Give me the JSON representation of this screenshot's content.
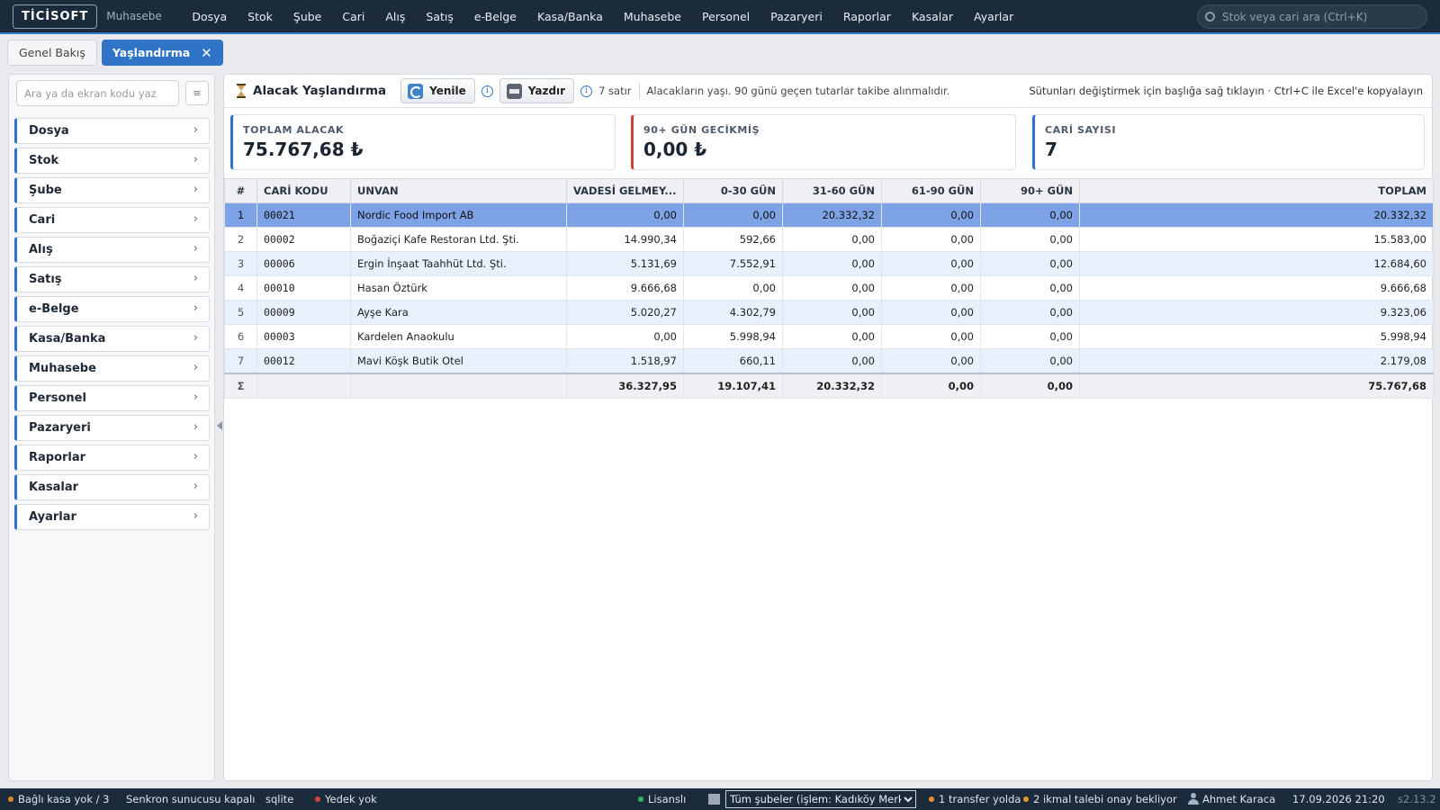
{
  "header": {
    "logo": "TİCİSOFT",
    "app_name": "Muhasebe",
    "menu": [
      "Dosya",
      "Stok",
      "Şube",
      "Cari",
      "Alış",
      "Satış",
      "e-Belge",
      "Kasa/Banka",
      "Muhasebe",
      "Personel",
      "Pazaryeri",
      "Raporlar",
      "Kasalar",
      "Ayarlar"
    ],
    "search_placeholder": "Stok veya cari ara (Ctrl+K)"
  },
  "tabs": {
    "overview": "Genel Bakış",
    "active": "Yaşlandırma",
    "close": "✕"
  },
  "sidebar": {
    "search_placeholder": "Ara ya da ekran kodu yaz",
    "menu_button": "≡",
    "items": [
      "Dosya",
      "Stok",
      "Şube",
      "Cari",
      "Alış",
      "Satış",
      "e-Belge",
      "Kasa/Banka",
      "Muhasebe",
      "Personel",
      "Pazaryeri",
      "Raporlar",
      "Kasalar",
      "Ayarlar"
    ]
  },
  "toolbar": {
    "title": "Alacak Yaşlandırma",
    "refresh": "Yenile",
    "print": "Yazdır",
    "row_count": "7 satır",
    "note": "Alacakların yaşı. 90 günü geçen tutarlar takibe alınmalıdır.",
    "hint": "Sütunları değiştirmek için başlığa sağ tıklayın · Ctrl+C ile Excel'e kopyalayın"
  },
  "cards": [
    {
      "label": "TOPLAM ALACAK",
      "value": "75.767,68 ₺"
    },
    {
      "label": "90+ GÜN GECİKMİŞ",
      "value": "0,00 ₺"
    },
    {
      "label": "CARİ SAYISI",
      "value": "7"
    }
  ],
  "table": {
    "headers": [
      "#",
      "CARİ KODU",
      "UNVAN",
      "VADESİ GELMEY...",
      "0-30 GÜN",
      "31-60 GÜN",
      "61-90 GÜN",
      "90+ GÜN",
      "TOPLAM"
    ],
    "rows": [
      [
        "1",
        "00021",
        "Nordic Food Import AB",
        "0,00",
        "0,00",
        "20.332,32",
        "0,00",
        "0,00",
        "20.332,32"
      ],
      [
        "2",
        "00002",
        "Boğaziçi Kafe Restoran Ltd. Şti.",
        "14.990,34",
        "592,66",
        "0,00",
        "0,00",
        "0,00",
        "15.583,00"
      ],
      [
        "3",
        "00006",
        "Ergin İnşaat Taahhüt Ltd. Şti.",
        "5.131,69",
        "7.552,91",
        "0,00",
        "0,00",
        "0,00",
        "12.684,60"
      ],
      [
        "4",
        "00010",
        "Hasan Öztürk",
        "9.666,68",
        "0,00",
        "0,00",
        "0,00",
        "0,00",
        "9.666,68"
      ],
      [
        "5",
        "00009",
        "Ayşe Kara",
        "5.020,27",
        "4.302,79",
        "0,00",
        "0,00",
        "0,00",
        "9.323,06"
      ],
      [
        "6",
        "00003",
        "Kardelen Anaokulu",
        "0,00",
        "5.998,94",
        "0,00",
        "0,00",
        "0,00",
        "5.998,94"
      ],
      [
        "7",
        "00012",
        "Mavi Köşk Butik Otel",
        "1.518,97",
        "660,11",
        "0,00",
        "0,00",
        "0,00",
        "2.179,08"
      ]
    ],
    "total": [
      "Σ",
      "",
      "",
      "36.327,95",
      "19.107,41",
      "20.332,32",
      "0,00",
      "0,00",
      "75.767,68"
    ]
  },
  "status": {
    "cash": "Bağlı kasa yok / 3",
    "sync": "Senkron sunucusu kapalı",
    "db": "sqlite",
    "backup": "Yedek yok",
    "license": "Lisanslı",
    "branch": "Tüm şubeler (işlem: Kadıköy Merkez)",
    "transfer": "1 transfer yolda",
    "requests": "2 ikmal talebi onay bekliyor",
    "user": "Ahmet Karaca",
    "datetime": "17.09.2026 21:20",
    "version": "s2.13.2"
  },
  "colors": {
    "topbar": "#1c2b3c",
    "accent": "#2f74c6",
    "danger": "#c8443d",
    "selected_row": "#7da3e6",
    "alt_row": "#e8f1fb"
  }
}
